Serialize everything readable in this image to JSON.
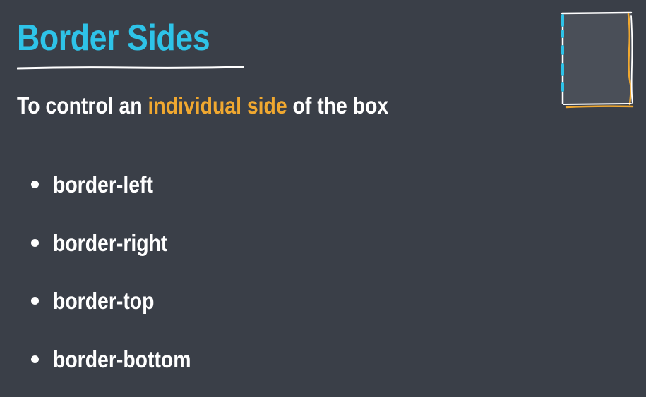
{
  "slide": {
    "title": "Border Sides",
    "subtitle_before": "To control an ",
    "subtitle_highlight": "individual side",
    "subtitle_after": " of the box",
    "bullets": [
      "border-left",
      "border-right",
      "border-top",
      "border-bottom"
    ]
  },
  "colors": {
    "background": "#3a3f48",
    "title": "#2ec3e8",
    "highlight": "#f0a830",
    "text": "#ffffff",
    "box_fill": "#4a4f58"
  },
  "icons": {
    "box_illustration": "box-with-border-sides-icon"
  }
}
